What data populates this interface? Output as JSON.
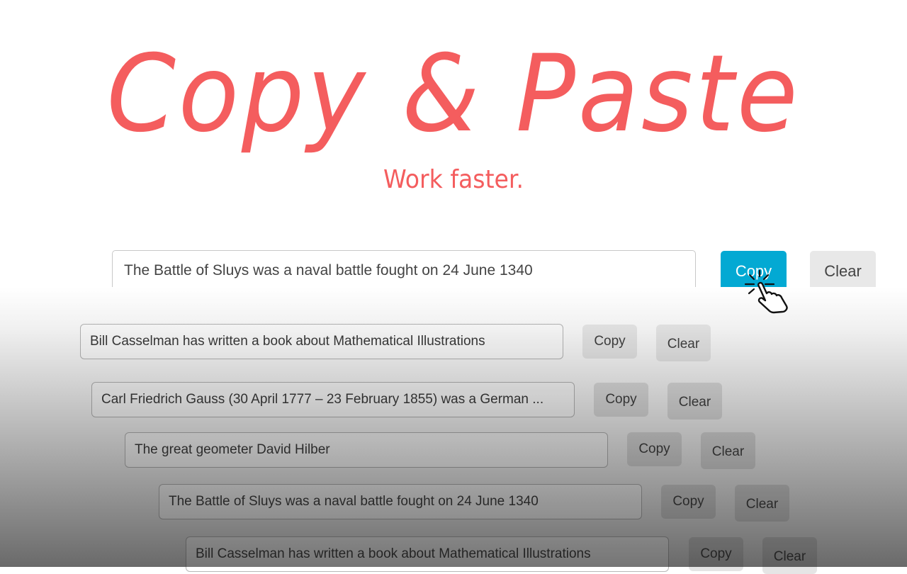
{
  "hero": {
    "title": "Copy & Paste",
    "subtitle": "Work faster.",
    "accent_color": "#f45d5e"
  },
  "main": {
    "input_value": "The Battle of Sluys was a naval battle fought on 24 June 1340",
    "copy_label": "Copy",
    "clear_label": "Clear",
    "copy_color": "#03a9d3"
  },
  "history": [
    {
      "text": "Bill Casselman has written a book about Mathematical Illustrations",
      "copy_label": "Copy",
      "clear_label": "Clear"
    },
    {
      "text": "Carl Friedrich Gauss (30 April 1777 – 23 February 1855) was a German  ...",
      "copy_label": "Copy",
      "clear_label": "Clear"
    },
    {
      "text": "The great geometer David Hilber",
      "copy_label": "Copy",
      "clear_label": "Clear"
    },
    {
      "text": "The Battle of Sluys was a naval battle fought on 24 June 1340",
      "copy_label": "Copy",
      "clear_label": "Clear"
    },
    {
      "text": "Bill Casselman has written a book about Mathematical Illustrations",
      "copy_label": "Copy",
      "clear_label": "Clear"
    }
  ],
  "cursor": {
    "icon": "hand-pointer-click-icon"
  }
}
